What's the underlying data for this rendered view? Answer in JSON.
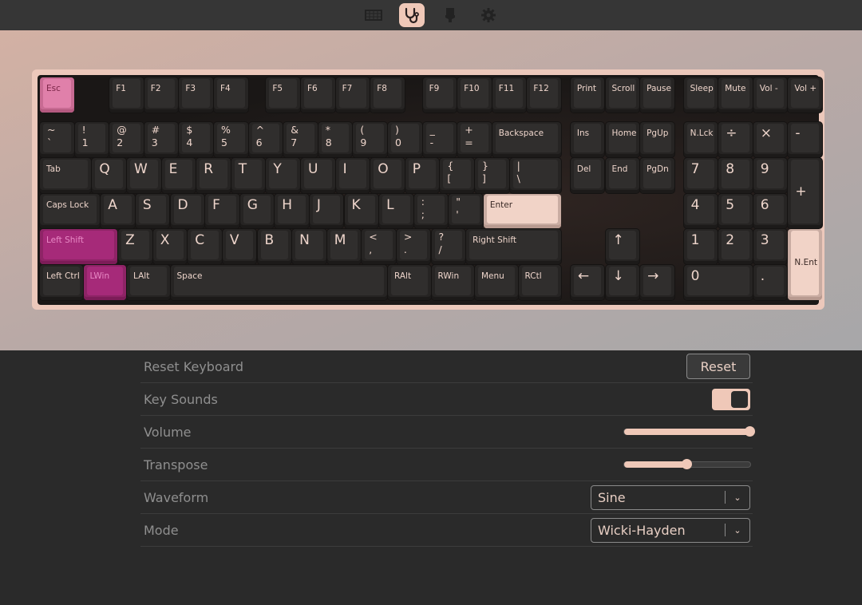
{
  "nav": {
    "tabs": [
      {
        "icon": "keyboard-icon",
        "active": false
      },
      {
        "icon": "stethoscope-icon",
        "active": true
      },
      {
        "icon": "brush-icon",
        "active": false
      },
      {
        "icon": "gear-icon",
        "active": false
      }
    ]
  },
  "colors": {
    "accent": "#efc8b8",
    "esc": "#e080aa",
    "modifier_pressed": "#a62a79",
    "pressed": "#f1d3c7"
  },
  "keyboard": {
    "rows": [
      [
        "Esc",
        "F1",
        "F2",
        "F3",
        "F4",
        "F5",
        "F6",
        "F7",
        "F8",
        "F9",
        "F10",
        "F11",
        "F12",
        "Print",
        "Scroll",
        "Pause",
        "Sleep",
        "Mute",
        "Vol -",
        "Vol +"
      ],
      [
        "~\n`",
        "!\n1",
        "@\n2",
        "#\n3",
        "$\n4",
        "%\n5",
        "^\n6",
        "&\n7",
        "*\n8",
        "(\n9",
        ")\n0",
        "_\n-",
        "+\n=",
        "Backspace",
        "Ins",
        "Home",
        "PgUp",
        "N.Lck",
        "÷",
        "×",
        "-"
      ],
      [
        "Tab",
        "Q",
        "W",
        "E",
        "R",
        "T",
        "Y",
        "U",
        "I",
        "O",
        "P",
        "{\n[",
        "}\n]",
        "|\n\\",
        "Del",
        "End",
        "PgDn",
        "7",
        "8",
        "9",
        "+"
      ],
      [
        "Caps Lock",
        "A",
        "S",
        "D",
        "F",
        "G",
        "H",
        "J",
        "K",
        "L",
        ":\n;",
        "\"\n'",
        "Enter",
        "4",
        "5",
        "6"
      ],
      [
        "Left Shift",
        "Z",
        "X",
        "C",
        "V",
        "B",
        "N",
        "M",
        "<\n,",
        ">\n.",
        "?\n/",
        "Right Shift",
        "↑",
        "1",
        "2",
        "3",
        "N.Ent"
      ],
      [
        "Left Ctrl",
        "LWin",
        "LAlt",
        "Space",
        "RAlt",
        "RWin",
        "Menu",
        "RCtl",
        "←",
        "↓",
        "→",
        "0",
        "."
      ]
    ],
    "highlighted": {
      "Esc": "pink",
      "Left Shift": "mag",
      "LWin": "mag",
      "Enter": "peach",
      "N.Ent": "peach"
    }
  },
  "settings": {
    "reset": {
      "label": "Reset Keyboard",
      "button": "Reset"
    },
    "key_sounds": {
      "label": "Key Sounds",
      "on": true
    },
    "volume": {
      "label": "Volume",
      "value": 1.0
    },
    "transpose": {
      "label": "Transpose",
      "value": 0.5
    },
    "waveform": {
      "label": "Waveform",
      "value": "Sine"
    },
    "mode": {
      "label": "Mode",
      "value": "Wicki-Hayden"
    }
  }
}
